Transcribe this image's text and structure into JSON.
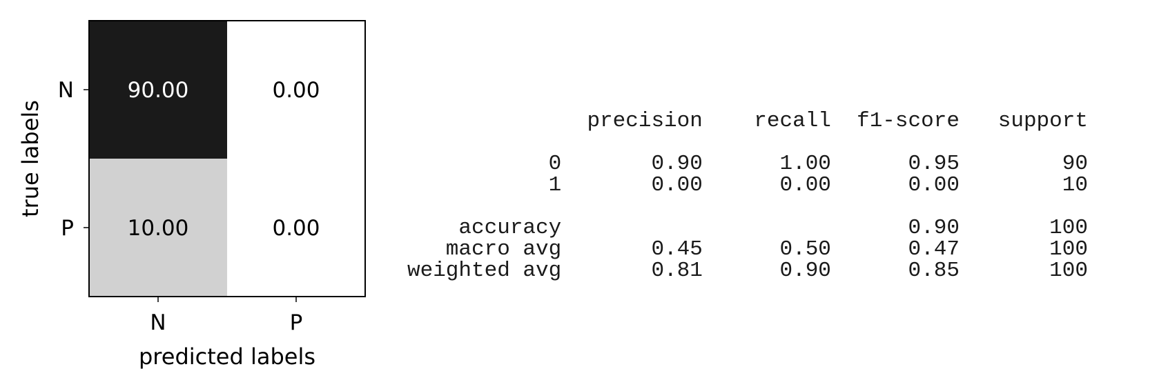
{
  "chart_data": [
    {
      "type": "heatmap",
      "title": "",
      "xlabel": "predicted labels",
      "ylabel": "true labels",
      "x_categories": [
        "N",
        "P"
      ],
      "y_categories": [
        "N",
        "P"
      ],
      "values": [
        [
          90.0,
          0.0
        ],
        [
          10.0,
          0.0
        ]
      ],
      "value_labels": [
        [
          "90.00",
          "0.00"
        ],
        [
          "10.00",
          "0.00"
        ]
      ],
      "colormap": "greys",
      "value_range": [
        0,
        90
      ]
    },
    {
      "type": "table",
      "columns": [
        "",
        "precision",
        "recall",
        "f1-score",
        "support"
      ],
      "rows": [
        [
          "0",
          "0.90",
          "1.00",
          "0.95",
          "90"
        ],
        [
          "1",
          "0.00",
          "0.00",
          "0.00",
          "10"
        ],
        [
          "accuracy",
          "",
          "",
          "0.90",
          "100"
        ],
        [
          "macro avg",
          "0.45",
          "0.50",
          "0.47",
          "100"
        ],
        [
          "weighted avg",
          "0.81",
          "0.90",
          "0.85",
          "100"
        ]
      ]
    }
  ],
  "report": {
    "lines": [
      "              precision    recall  f1-score   support",
      "",
      "           0       0.90      1.00      0.95        90",
      "           1       0.00      0.00      0.00        10",
      "",
      "    accuracy                           0.90       100",
      "   macro avg       0.45      0.50      0.47       100",
      "weighted avg       0.81      0.90      0.85       100"
    ]
  },
  "colors": {
    "high": "#1a1a1a",
    "low": "#ffffff",
    "text_dark": "#000000",
    "text_light": "#ffffff"
  }
}
